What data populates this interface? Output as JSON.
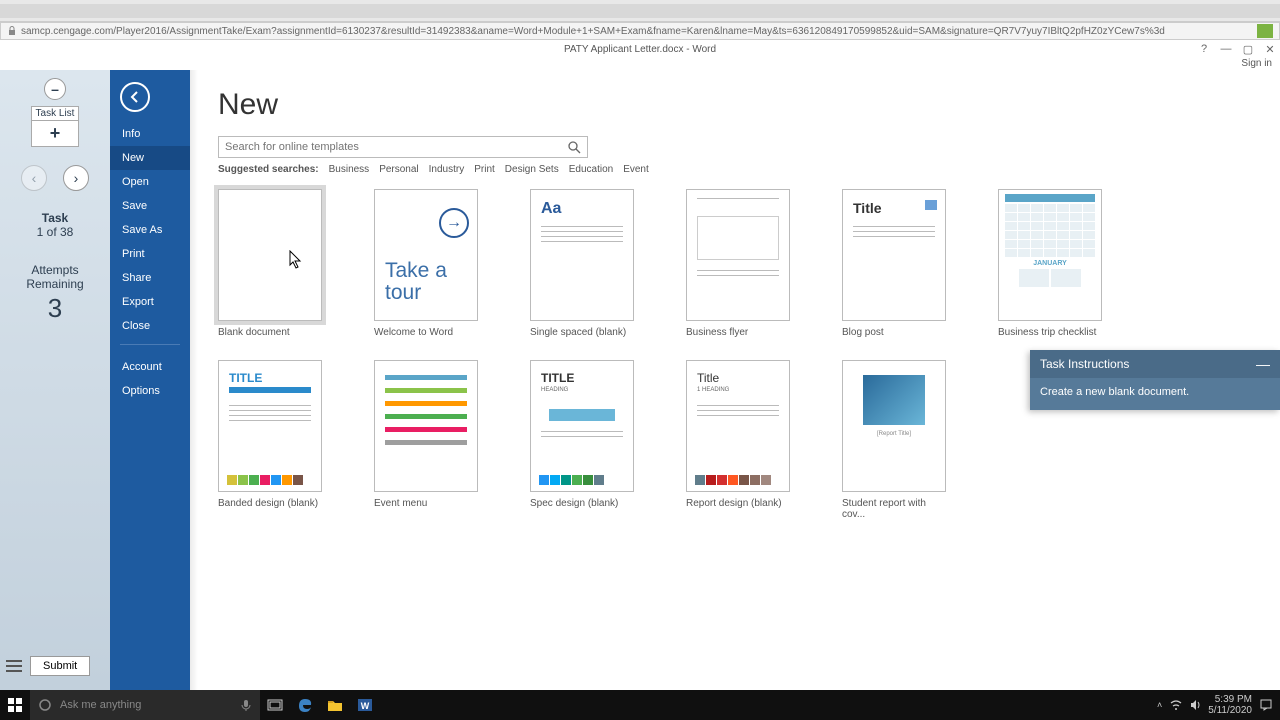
{
  "browser": {
    "url": "samcp.cengage.com/Player2016/AssignmentTake/Exam?assignmentId=6130237&resultId=31492383&aname=Word+Module+1+SAM+Exam&fname=Karen&lname=May&ts=636120849170599852&uid=SAM&signature=QR7V7yuy7IBltQ2pfHZ0zYCew7s%3d"
  },
  "window": {
    "title": "PATY Applicant Letter.docx - Word",
    "signin": "Sign in"
  },
  "assess": {
    "tasklist_label": "Task List",
    "task_header": "Task",
    "task_counter": "1 of 38",
    "attempts_label": "Attempts Remaining",
    "attempts_value": "3",
    "submit": "Submit"
  },
  "backstage": {
    "items": [
      "Info",
      "New",
      "Open",
      "Save",
      "Save As",
      "Print",
      "Share",
      "Export",
      "Close"
    ],
    "bottom": [
      "Account",
      "Options"
    ]
  },
  "content": {
    "title": "New",
    "search_placeholder": "Search for online templates",
    "suggested_label": "Suggested searches:",
    "suggested": [
      "Business",
      "Personal",
      "Industry",
      "Print",
      "Design Sets",
      "Education",
      "Event"
    ],
    "templates_row1": [
      {
        "name": "Blank document"
      },
      {
        "name": "Welcome to Word",
        "tour": "Take a tour"
      },
      {
        "name": "Single spaced (blank)",
        "aa": "Aa"
      },
      {
        "name": "Business flyer"
      },
      {
        "name": "Blog post",
        "title": "Title"
      },
      {
        "name": "Business trip checklist",
        "month": "JANUARY"
      }
    ],
    "templates_row2": [
      {
        "name": "Banded design (blank)",
        "title": "TITLE"
      },
      {
        "name": "Event menu"
      },
      {
        "name": "Spec design (blank)",
        "title": "TITLE",
        "sub": "HEADING"
      },
      {
        "name": "Report design (blank)",
        "title": "Title",
        "sub": "1   HEADING"
      },
      {
        "name": "Student report with cov...",
        "cap": "[Report Title]"
      }
    ]
  },
  "instructions": {
    "header": "Task Instructions",
    "body": "Create a new blank document."
  },
  "taskbar": {
    "search": "Ask me anything",
    "time": "5:39 PM",
    "date": "5/11/2020"
  }
}
